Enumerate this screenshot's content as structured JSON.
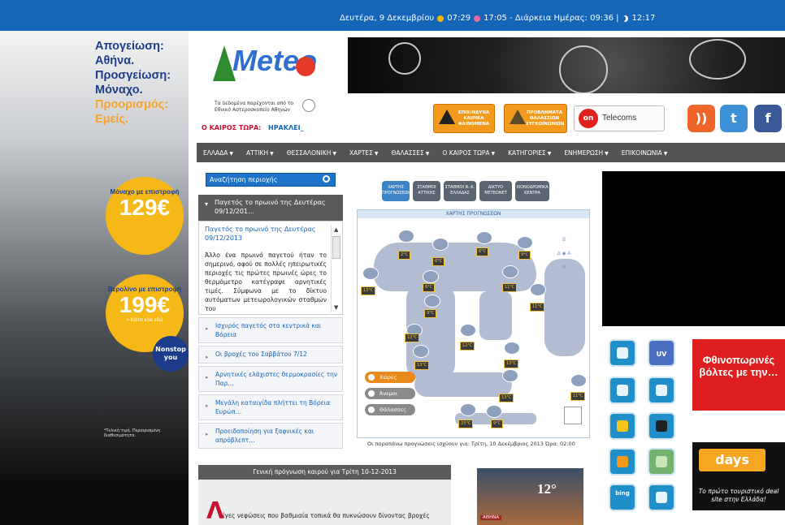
{
  "topbar": {
    "date": "Δευτέρα, 9 Δεκεμβρίου",
    "sunrise": "07:29",
    "sunset": "17:05 - Διάρκεια Ημέρας: 09:36 |",
    "moon": "12:17"
  },
  "left_ad": {
    "l1": "Απογείωση:",
    "l2": "Αθήνα.",
    "l3": "Προσγείωση:",
    "l4": "Μόναχο.",
    "l5": "Προορισμός:",
    "l6": "Εμείς.",
    "badge1_title": "Μόναχο με επιστροφή",
    "badge1_price": "129€",
    "badge2_title": "Βερολίνο με επιστροφή",
    "badge2_price": "199€",
    "badge2_sub": "> Κάντε κλικ εδώ",
    "nonstop": "Nonstop you",
    "note": "*Τελική τιμή. Περιορισμένη διαθεσιμότητα."
  },
  "header": {
    "logo": "Meteo",
    "observatory": "Τα δεδομένα παρέχονται από το Εθνικό Αστεροσκοπείο Αθηνών",
    "now_label": "Ο ΚΑΙΡΟΣ ΤΩΡΑ:",
    "now_value": "ΗΡΑΚΛΕΙ_",
    "alert1": "ΕΠΙΚΙΝΔΥΝΑ ΚΑΙΡΙΚΑ ΦΑΙΝΟΜΕΝΑ",
    "alert2": "ΠΡΟΒΛΗΜΑΤΑ ΘΑΛΑΣΣΙΩΝ ΣΥΓΚΟΙΝΩΝΙΩΝ",
    "telecoms_logo": "on",
    "telecoms": "Telecoms",
    "social_rss": "rss-icon",
    "social_twitter": "twitter-icon",
    "social_facebook": "facebook-icon"
  },
  "nav": [
    "ΕΛΛΑΔΑ",
    "ΑΤΤΙΚΗ",
    "ΘΕΣΣΑΛΟΝΙΚΗ",
    "ΧΑΡΤΕΣ",
    "ΘΑΛΑΣΣΕΣ",
    "Ο ΚΑΙΡΟΣ ΤΩΡΑ",
    "ΚΑΤΗΓΟΡΙΕΣ",
    "ΕΝΗΜΕΡΩΣΗ",
    "ΕΠΙΚΟΙΝΩΝΙΑ"
  ],
  "sidebar": {
    "search_placeholder": "Αναζήτηση περιοχής",
    "head": "Παγετός το πρωινό της Δευτέρας 09/12/201…",
    "article_title": "Παγετός το πρωινό της Δευτέρας 09/12/2013",
    "article_text": "Άλλο ένα πρωινό παγετού ήταν το σημερινό, αφού σε πολλές ηπειρωτικές περιοχές τις πρώτες πρωινές ώρες το θερμόμετρο κατέγραψε αρνητικές τιμές. Σύμφωνα με το δίκτυο αυτόματων μετεωρολογικών σταθμών του",
    "items": [
      "Ισχυρός παγετός στα κεντρικά και Βόρεια",
      "Οι βροχές του Σαββάτου 7/12",
      "Αρνητικές ελάχιστες θερμοκρασίες την Παρ…",
      "Μεγάλη καταιγίδα πλήττει τη Βόρεια Ευρώπ…",
      "Προειδοποίηση για ξαφνικές και απρόβλεπτ…"
    ]
  },
  "map": {
    "tabs": [
      "ΧΑΡΤΗΣ ΠΡΟΓΝΩΣΕΩΝ",
      "ΣΤΑΘΜΟΙ ΑΤΤΙΚΗΣ",
      "ΣΤΑΘΜΟΙ Β.-Κ. ΕΛΛΑΔΑΣ",
      "ΔΙΚΤΥΟ ΜΕΤΕΟNET",
      "ΧΙΟΝΟΔΡΟΜΙΚΑ ΚΕΝΤΡΑ"
    ],
    "caption": "ΧΑΡΤΗΣ ΠΡΟΓΝΩΣΕΩΝ",
    "temps": [
      "2°C",
      "6°C",
      "6°C",
      "9°C",
      "13°C",
      "6°C",
      "11°C",
      "11°C",
      "9°C",
      "12°C",
      "12°C",
      "13°C",
      "13°C",
      "13°C",
      "13°C",
      "13°C",
      "11°C",
      "15°C",
      "9°C"
    ],
    "legend": [
      "Χώρες",
      "Άνεμοι",
      "Θάλασσες"
    ],
    "compass": {
      "n": "Β",
      "s": "Ν",
      "w": "Δ",
      "e": "Α"
    },
    "note": "Οι παραπάνω προγνώσεις ισχύουν για: Τρίτη, 10 Δεκέμβριος 2013 Ώρα: 02:00"
  },
  "right": {
    "tile_uv": "UV",
    "tile_bing": "bing",
    "red_ad": "Φθινοπωρινές βόλτες με την…",
    "days_brand": "days",
    "days_desc": "Το πρώτο τουριστικό deal site στην Ελλάδα!"
  },
  "bottom": {
    "general_head": "Γενική πρόγνωση καιρού για Τρίτη 10-12-2013",
    "dropcap": "Λ",
    "general_text": "ίγες νεφώσεις που βαθμιαία τοπικά θα πυκνώσουν δίνοντας βροχές",
    "athens_temp": "12°",
    "athens_label": "ΑΘΗΝΑ"
  },
  "colors": {
    "topbar": "#1565b8",
    "nav": "#545454",
    "accent_red": "#c8102e",
    "alert_orange": "#f39a1c"
  }
}
